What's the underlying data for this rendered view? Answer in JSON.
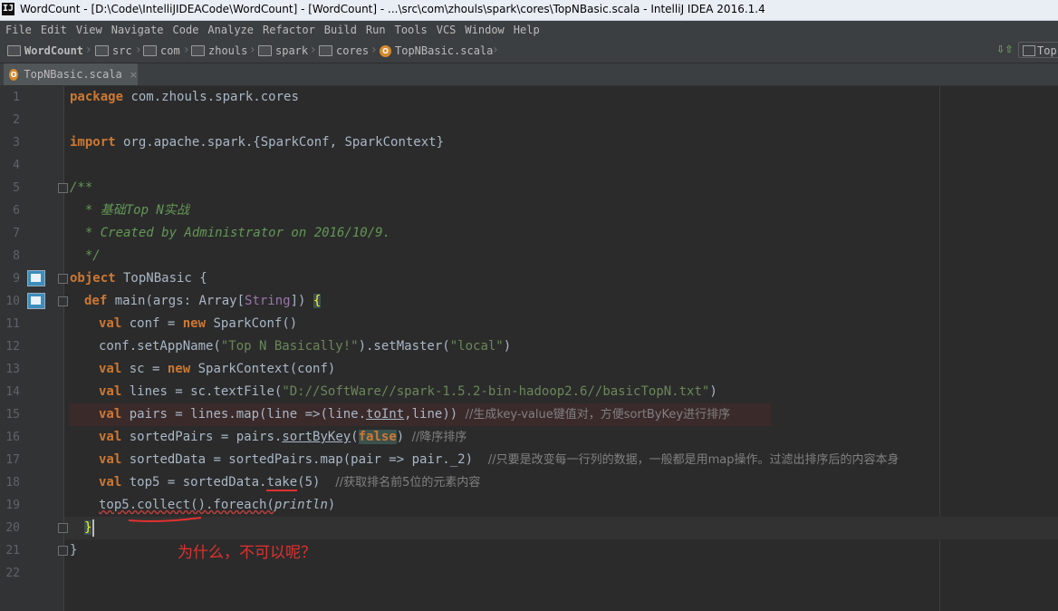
{
  "window": {
    "app_icon_text": "IJ",
    "title": "WordCount - [D:\\Code\\IntelliJIDEACode\\WordCount] - [WordCount] - ...\\src\\com\\zhouls\\spark\\cores\\TopNBasic.scala - IntelliJ IDEA 2016.1.4"
  },
  "menu": [
    "File",
    "Edit",
    "View",
    "Navigate",
    "Code",
    "Analyze",
    "Refactor",
    "Build",
    "Run",
    "Tools",
    "VCS",
    "Window",
    "Help"
  ],
  "breadcrumb": [
    "WordCount",
    "src",
    "com",
    "zhouls",
    "spark",
    "cores",
    "TopNBasic.scala"
  ],
  "file_icon_letter": "O",
  "navbar_right": {
    "label": "Top"
  },
  "tab": {
    "label": "TopNBasic.scala",
    "close": "×"
  },
  "line_numbers": [
    "1",
    "2",
    "3",
    "4",
    "5",
    "6",
    "7",
    "8",
    "9",
    "10",
    "11",
    "12",
    "13",
    "14",
    "15",
    "16",
    "17",
    "18",
    "19",
    "20",
    "21",
    "22"
  ],
  "code": {
    "l1": {
      "kw": "package",
      "rest": " com.zhouls.spark.cores"
    },
    "l3": {
      "kw": "import",
      "rest": " org.apache.spark.{SparkConf, SparkContext}"
    },
    "l5": "/**",
    "l6": "  * 基础Top N实战",
    "l7": "  * Created by Administrator on 2016/10/9.",
    "l8": "  */",
    "l9": {
      "kw": "object",
      "rest": " TopNBasic {"
    },
    "l10": {
      "kw": "def",
      "name": " main(args: Array[",
      "type": "String",
      "end": "]) ",
      "brace": "{"
    },
    "l11": {
      "kw": "val",
      "a": " conf = ",
      "kw2": "new",
      "b": " SparkConf()"
    },
    "l12": {
      "a": "conf.setAppName(",
      "str": "\"Top N Basically!\"",
      "b": ").setMaster(",
      "str2": "\"local\"",
      "c": ")"
    },
    "l13": {
      "kw": "val",
      "a": " sc = ",
      "kw2": "new",
      "b": " SparkContext(conf)"
    },
    "l14": {
      "kw": "val",
      "a": " lines = sc.textFile(",
      "str": "\"D://SoftWare//spark-1.5.2-bin-hadoop2.6//basicTopN.txt\"",
      "b": ")"
    },
    "l15": {
      "kw": "val",
      "a": " pairs = lines.map(line =>(line.",
      "u": "toInt",
      "b": ",line)) ",
      "cmt": "//生成key-value键值对，方便sortByKey进行排序"
    },
    "l16": {
      "kw": "val",
      "a": " sortedPairs = pairs.",
      "u": "sortByKey",
      "b": "(",
      "kw2": "false",
      "c": ") ",
      "cmt": "//降序排序"
    },
    "l17": {
      "kw": "val",
      "a": " sortedData = sortedPairs.map(pair => pair._2)  ",
      "cmt": "//只要是改变每一行列的数据，一般都是用map操作。过滤出排序后的内容本身"
    },
    "l18": {
      "kw": "val",
      "a": " top5 = sortedData.",
      "u": "take",
      "b": "(5)  ",
      "cmt": "//获取排名前5位的元素内容"
    },
    "l19": {
      "a": "top5.collect().foreach(",
      "it": "println",
      "b": ")"
    },
    "l20": "}",
    "l21": "}"
  },
  "annotation": "为什么，不可以呢？"
}
